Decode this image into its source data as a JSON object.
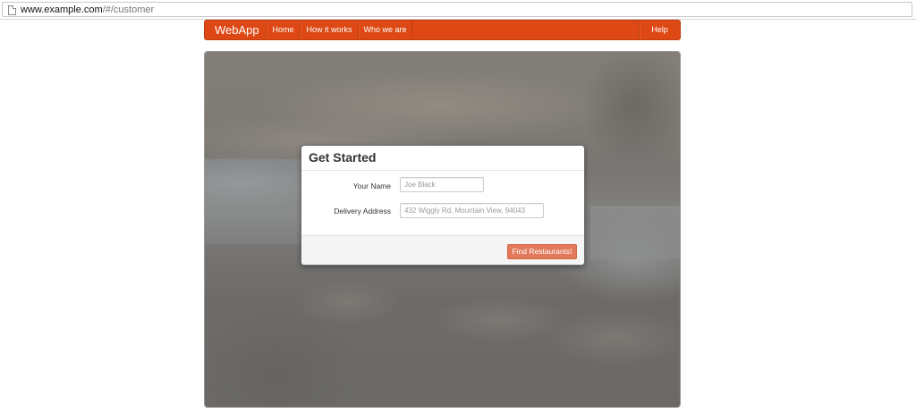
{
  "browser": {
    "url_host": "www.example.com",
    "url_path": "/#/customer"
  },
  "navbar": {
    "brand": "WebApp",
    "items": [
      {
        "label": "Home"
      },
      {
        "label": "How it works"
      },
      {
        "label": "Who we are"
      }
    ],
    "help": "Help",
    "color": "#dd4814"
  },
  "modal": {
    "title": "Get Started",
    "name_label": "Your Name",
    "name_placeholder": "Joe Black",
    "address_label": "Delivery Address",
    "address_placeholder": "432 Wiggly Rd, Mountain View, 94043",
    "submit_label": "Find Restaurants!",
    "button_color": "#e2795a"
  }
}
